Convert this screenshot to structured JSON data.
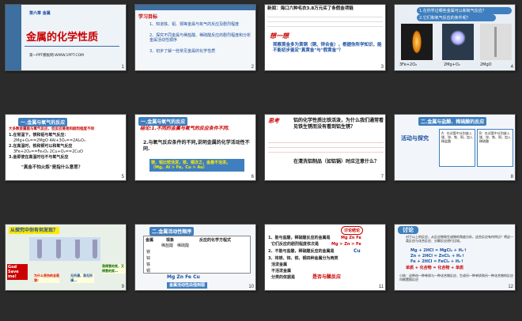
{
  "slides": [
    {
      "num": "1",
      "chapter": "第六章 金属",
      "title": "金属的化学性质",
      "footer": "第一PPT模板网-WWW.1PPT.COM"
    },
    {
      "num": "2",
      "heading": "学习目标",
      "items": [
        "1、知道铁、铝、铜等金属与氧气的反应及剧烈程度",
        "2、探究不同金属与稀盐酸、稀硫酸反应的剧烈程度和分析金属活动性顺序",
        "3、初步了解一些常见金属的化学性质"
      ]
    },
    {
      "num": "3",
      "news": "新闻：海口六种毛衣3.8万元买了条假金项链",
      "think": "想一想",
      "question": "观察黄金多为黄铜（铜、锌合金），根据你所学知识，能不能初步鉴定\"真黄金\"与\"假黄金\"？"
    },
    {
      "num": "4",
      "q1": "1.在你学过哪些金属可以和氧气反应？",
      "q2": "2.它们和氧气反应的条件呢？",
      "eq1": "3Fe+2O₂",
      "eq2": "2Mg+O₂",
      "eq3": "2MgO"
    },
    {
      "num": "5",
      "heading": "一.金属与氧气的反应",
      "lines": [
        "大多数金属能与氧气反应，但反应难易和剧烈程度不同",
        "1.在常温下，镁和铝与氧气反应：",
        "2Mg+O₂==2MgO   4Al+3O₂==2Al₂O₃",
        "2.在高温时，铁和铜可以和氧气反应",
        "3Fe+2O₂==Fe₃O₄  2Cu+O₂==2CuO",
        "3.金即使在高温时也不与氧气反应"
      ],
      "quote": "\"真金不怕火炼\"是指什么意思？"
    },
    {
      "num": "6",
      "heading": "一.金属与氧气的反应",
      "conclusion1": "结论:1.不同的金属与氧气的反应条件不同.",
      "conclusion2": "2.与氧气反应条件的不同,说明金属的化学活动性不同.",
      "highlight": "镁、铝比较活泼，铁、铜次之，金最不活泼。（Mg，Al > Fe，Cu > Au）"
    },
    {
      "num": "7",
      "think": "思考",
      "text": "铝的化学性质比铁活泼，为什么我们通常看见铁生锈而没有看到铝生锈？",
      "question": "在清洗铝制品（如铝锅）时应注意什么？"
    },
    {
      "num": "8",
      "heading": "二.金属与盐酸、稀硫酸的反应",
      "activity": "活动与探究",
      "box1": "A：在试管中分别放入镁、锌、铁、铜，加入稀盐酸",
      "box2": "B：在试管中分别放入镁、锌、铁、铜，加入稀硫酸"
    },
    {
      "num": "9",
      "heading": "从探究中你有何发现？",
      "label1": "God Save me!",
      "label2": "为什么受伤的总是我！",
      "label3": "无所谓，我无所谓…",
      "label4": "我得意的笑，又得意的笑…"
    },
    {
      "num": "10",
      "heading": "二.金属活动性顺序",
      "cols": [
        "金属",
        "现象",
        "反应的化学方程式"
      ],
      "sub": [
        "稀盐酸",
        "稀硫酸"
      ],
      "rows": [
        "镁",
        "锌",
        "铁",
        "铜"
      ],
      "order": "Mg  Zn  Fe  Cu",
      "footer": "金属活动性由强到弱"
    },
    {
      "num": "11",
      "bubble": "讨论结论",
      "l1": "1、能与盐酸，稀硫酸反应的金属是",
      "m1": "Mg  Zn  Fe",
      "l2": "它们反应的剧烈程度依次是",
      "m2": "Mg  >  Zn  >  Fe",
      "l3": "2、不能与盐酸，稀硫酸反应的金属是",
      "m3": "Cu",
      "l4": "3、将镁、锌、铁、铜四种金属分为两类",
      "l5": "活泼金属",
      "l6": "不活泼金属",
      "l7": "分类的依据是",
      "l8": "是否与酸反应"
    },
    {
      "num": "12",
      "heading": "讨论",
      "text": "对于以上的反应，从反应物和生成物的角度分析，这些反应有何特点？将这一类反应与化合反应、分解反应进行比较。",
      "eq": [
        "Mg + 2HCl = MgCl₂ + H₂↑",
        "Zn + 2HCl = ZnCl₂ + H₂↑",
        "Fe + 2HCl = FeCl₂ + H₂↑"
      ],
      "labels": "单质 + 化合物 = 化合物 + 单质",
      "summary": "小结：这种由一种单质与一种化合物反应，生成另一种单质和另一种化合物的反应叫做置换反应"
    }
  ]
}
